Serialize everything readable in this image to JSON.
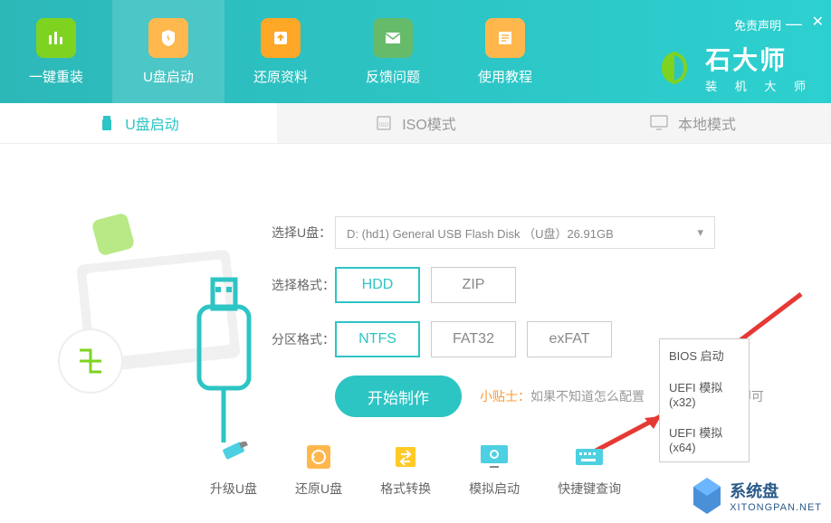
{
  "header": {
    "disclaimer": "免责声明",
    "nav": [
      {
        "label": "一键重装",
        "icon": "reinstall"
      },
      {
        "label": "U盘启动",
        "icon": "usb-boot"
      },
      {
        "label": "还原资料",
        "icon": "restore"
      },
      {
        "label": "反馈问题",
        "icon": "feedback"
      },
      {
        "label": "使用教程",
        "icon": "tutorial"
      }
    ],
    "brand_title": "石大师",
    "brand_sub": "装 机 大 师"
  },
  "tabs": [
    {
      "label": "U盘启动"
    },
    {
      "label": "ISO模式"
    },
    {
      "label": "本地模式"
    }
  ],
  "form": {
    "usb_label": "选择U盘：",
    "usb_value": "D: (hd1) General USB Flash Disk （U盘）26.91GB",
    "format_label": "选择格式：",
    "format_options": [
      "HDD",
      "ZIP"
    ],
    "partition_label": "分区格式：",
    "partition_options": [
      "NTFS",
      "FAT32",
      "exFAT"
    ],
    "start_btn": "开始制作",
    "tip_label": "小贴士：",
    "tip_content": "如果不知道怎么配置",
    "tip_suffix": "即可"
  },
  "popup": {
    "items": [
      "BIOS 启动",
      "UEFI 模拟(x32)",
      "UEFI 模拟(x64)"
    ]
  },
  "tools": [
    {
      "label": "升级U盘"
    },
    {
      "label": "还原U盘"
    },
    {
      "label": "格式转换"
    },
    {
      "label": "模拟启动"
    },
    {
      "label": "快捷键查询"
    }
  ],
  "watermark": {
    "title": "系统盘",
    "url": "XITONGPAN.NET"
  }
}
